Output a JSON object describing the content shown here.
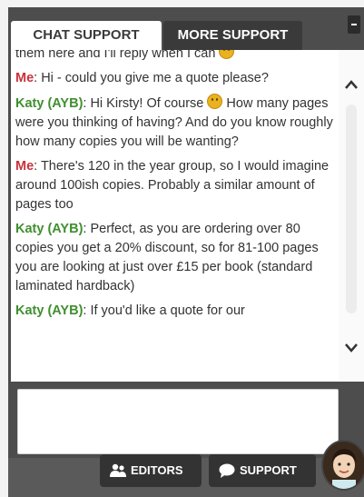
{
  "tabs": [
    {
      "label": "CHAT SUPPORT"
    },
    {
      "label": "MORE SUPPORT"
    }
  ],
  "messages": [
    {
      "sender": "",
      "text": "them here and I'll reply when I can "
    },
    {
      "sender": "Me",
      "text": ": Hi - could you give me a quote please?"
    },
    {
      "sender": "Katy (AYB)",
      "text": ": Hi Kirsty! Of course ",
      "after": " How many pages were you thinking of having? And do you know roughly how many copies you will be wanting?"
    },
    {
      "sender": "Me",
      "text": ": There's 120 in the year group, so I would imagine around 100ish copies. Probably a similar amount of pages too"
    },
    {
      "sender": "Katy (AYB)",
      "text": ": Perfect, as you are ordering over 80 copies you get a 20% discount, so for 81-100 pages you are looking at just over £15 per book (standard laminated hardback)"
    },
    {
      "sender": "Katy (AYB)",
      "text": ": If you'd like a quote for our"
    }
  ],
  "footer": {
    "editors_label": "EDITORS",
    "support_label": "SUPPORT"
  },
  "icons": {
    "editors": "users-icon",
    "support": "speech-bubble-icon",
    "scroll_up": "chevron-up-icon",
    "scroll_down": "chevron-down-icon",
    "emoji": "smiley-emoji-icon"
  },
  "colors": {
    "me": "#c8323c",
    "agent": "#3f8f2f",
    "frame": "#4d4d4d"
  }
}
